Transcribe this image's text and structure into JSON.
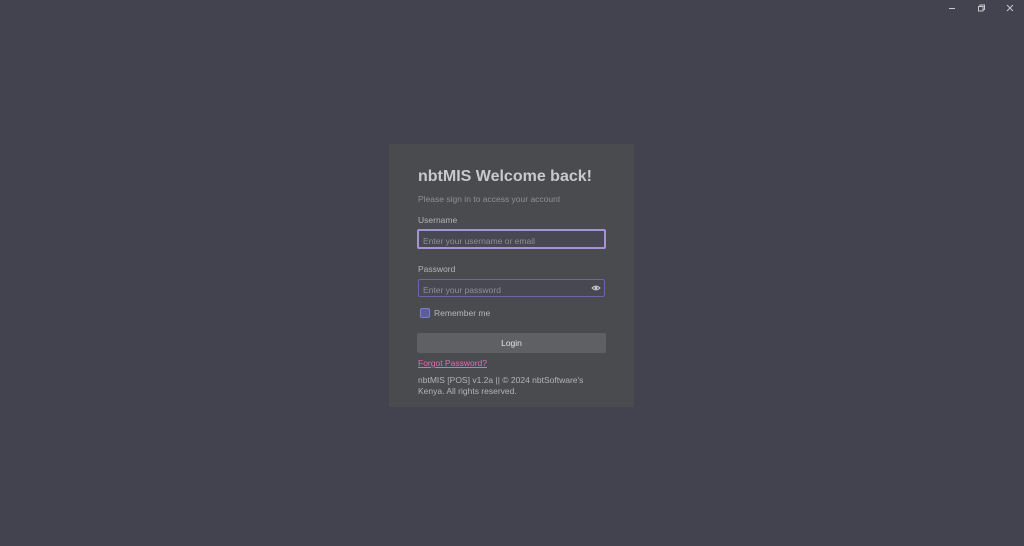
{
  "window": {
    "controls": {
      "minimize_icon": "minimize-icon",
      "restore_icon": "restore-icon",
      "close_icon": "close-icon"
    }
  },
  "login": {
    "title": "nbtMIS Welcome back!",
    "subtitle": "Please sign in to access your account",
    "username": {
      "label": "Username",
      "value": "",
      "placeholder": "Enter your username or email"
    },
    "password": {
      "label": "Password",
      "value": "",
      "placeholder": "Enter your password",
      "toggle_icon": "eye-icon"
    },
    "remember_me": {
      "label": "Remember me",
      "checked": false
    },
    "login_button": "Login",
    "forgot_password": "Forgot Password?",
    "footer": "nbtMIS [POS] v1.2a || © 2024 nbtSoftware's Kenya. All rights reserved."
  },
  "colors": {
    "background": "#42434f",
    "card": "#4a4b4e",
    "accent_focus": "#a693d6",
    "link": "#e06bb6",
    "button": "#5f6064"
  }
}
